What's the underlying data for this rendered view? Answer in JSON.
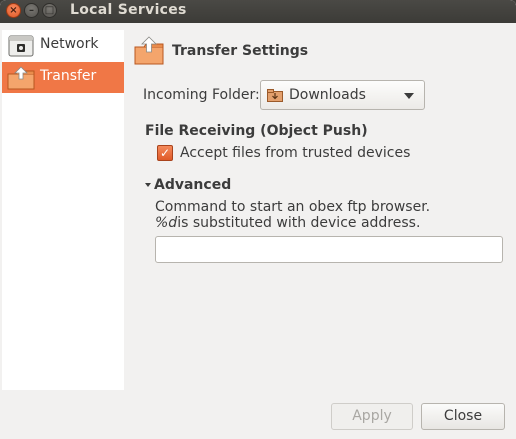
{
  "window": {
    "title": "Local Services",
    "controls": {
      "close": "×",
      "minimize": "–",
      "maximize": "□"
    }
  },
  "sidebar": {
    "items": [
      {
        "label": "Network",
        "icon": "network-server-icon",
        "selected": false
      },
      {
        "label": "Transfer",
        "icon": "folder-transfer-icon",
        "selected": true
      }
    ]
  },
  "main": {
    "header_title": "Transfer Settings",
    "incoming_folder": {
      "label": "Incoming Folder:",
      "value": "Downloads",
      "icon": "downloads-folder-icon"
    },
    "file_receiving": {
      "title": "File Receiving (Object Push)",
      "checkbox_label": "Accept files from trusted devices",
      "checked": true
    },
    "advanced": {
      "title": "Advanced",
      "expanded": true,
      "description_line1": "Command to start an obex ftp browser.",
      "description_code": "%d",
      "description_line2_rest": "is substituted with device address.",
      "command_value": ""
    }
  },
  "buttons": {
    "apply": "Apply",
    "apply_enabled": false,
    "close": "Close"
  },
  "colors": {
    "accent": "#f07746",
    "titlebar": "#3c3b37",
    "window_bg": "#f2f1f0"
  }
}
